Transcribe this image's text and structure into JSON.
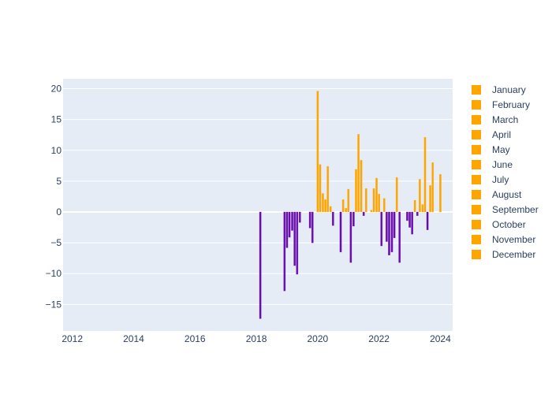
{
  "chart_data": {
    "type": "bar",
    "title": "",
    "xlabel": "",
    "ylabel": "",
    "xlim": [
      2011.7,
      2024.4
    ],
    "ylim": [
      -19.3,
      21.6
    ],
    "grid": true,
    "legend_position": "right",
    "x_ticks": [
      "2012",
      "2014",
      "2016",
      "2018",
      "2020",
      "2022",
      "2024"
    ],
    "x_tick_values": [
      2012,
      2014,
      2016,
      2018,
      2020,
      2022,
      2024
    ],
    "y_ticks": [
      "20",
      "15",
      "10",
      "5",
      "0",
      "−5",
      "−10",
      "−15"
    ],
    "y_tick_values": [
      20,
      15,
      10,
      5,
      0,
      -5,
      -10,
      -15
    ],
    "colors": {
      "positive": "#ffa500",
      "negative": "#6a0dad",
      "zero": "#ffffff",
      "plot_bg": "#e5ecf6",
      "grid": "#ffffff"
    },
    "legend": [
      "January",
      "February",
      "March",
      "April",
      "May",
      "June",
      "July",
      "August",
      "September",
      "October",
      "November",
      "December"
    ],
    "legend_color": "#ffa500",
    "series": [
      {
        "x": 2012.5,
        "value": 0
      },
      {
        "x": 2013.5,
        "value": 0
      },
      {
        "x": 2014.5,
        "value": 0
      },
      {
        "x": 2015.5,
        "value": 0
      },
      {
        "x": 2016.5,
        "value": 0
      },
      {
        "x": 2017.5,
        "value": 0
      },
      {
        "x": 2018.13,
        "value": -17.3
      },
      {
        "x": 2018.5,
        "value": 0
      },
      {
        "x": 2018.92,
        "value": -12.8
      },
      {
        "x": 2019.0,
        "value": -5.8
      },
      {
        "x": 2019.08,
        "value": -4.1
      },
      {
        "x": 2019.17,
        "value": -3.0
      },
      {
        "x": 2019.25,
        "value": -8.7
      },
      {
        "x": 2019.33,
        "value": -10.1
      },
      {
        "x": 2019.42,
        "value": -1.7
      },
      {
        "x": 2019.75,
        "value": -2.6
      },
      {
        "x": 2019.83,
        "value": -5.0
      },
      {
        "x": 2020.0,
        "value": 19.6
      },
      {
        "x": 2020.08,
        "value": 7.7
      },
      {
        "x": 2020.17,
        "value": 3.0
      },
      {
        "x": 2020.25,
        "value": 2.0
      },
      {
        "x": 2020.33,
        "value": 7.4
      },
      {
        "x": 2020.42,
        "value": 0.9
      },
      {
        "x": 2020.5,
        "value": -2.2
      },
      {
        "x": 2020.75,
        "value": -6.5
      },
      {
        "x": 2020.83,
        "value": 2.0
      },
      {
        "x": 2020.92,
        "value": 0.6
      },
      {
        "x": 2021.0,
        "value": 3.7
      },
      {
        "x": 2021.08,
        "value": -8.2
      },
      {
        "x": 2021.17,
        "value": -2.3
      },
      {
        "x": 2021.25,
        "value": 6.9
      },
      {
        "x": 2021.33,
        "value": 12.6
      },
      {
        "x": 2021.42,
        "value": 8.4
      },
      {
        "x": 2021.5,
        "value": -0.6
      },
      {
        "x": 2021.58,
        "value": 3.8
      },
      {
        "x": 2021.75,
        "value": 0.3
      },
      {
        "x": 2021.83,
        "value": 3.8
      },
      {
        "x": 2021.92,
        "value": 5.5
      },
      {
        "x": 2022.0,
        "value": 2.9
      },
      {
        "x": 2022.08,
        "value": -5.5
      },
      {
        "x": 2022.17,
        "value": 2.2
      },
      {
        "x": 2022.25,
        "value": -4.8
      },
      {
        "x": 2022.33,
        "value": -7.0
      },
      {
        "x": 2022.42,
        "value": -6.5
      },
      {
        "x": 2022.5,
        "value": -4.2
      },
      {
        "x": 2022.58,
        "value": 5.6
      },
      {
        "x": 2022.67,
        "value": -8.2
      },
      {
        "x": 2022.92,
        "value": -1.4
      },
      {
        "x": 2023.0,
        "value": -2.5
      },
      {
        "x": 2023.08,
        "value": -3.6
      },
      {
        "x": 2023.17,
        "value": 1.9
      },
      {
        "x": 2023.25,
        "value": -0.6
      },
      {
        "x": 2023.33,
        "value": 5.3
      },
      {
        "x": 2023.42,
        "value": 1.2
      },
      {
        "x": 2023.5,
        "value": 12.1
      },
      {
        "x": 2023.58,
        "value": -2.9
      },
      {
        "x": 2023.67,
        "value": 4.3
      },
      {
        "x": 2023.75,
        "value": 8.0
      },
      {
        "x": 2024.0,
        "value": 6.1
      }
    ]
  }
}
